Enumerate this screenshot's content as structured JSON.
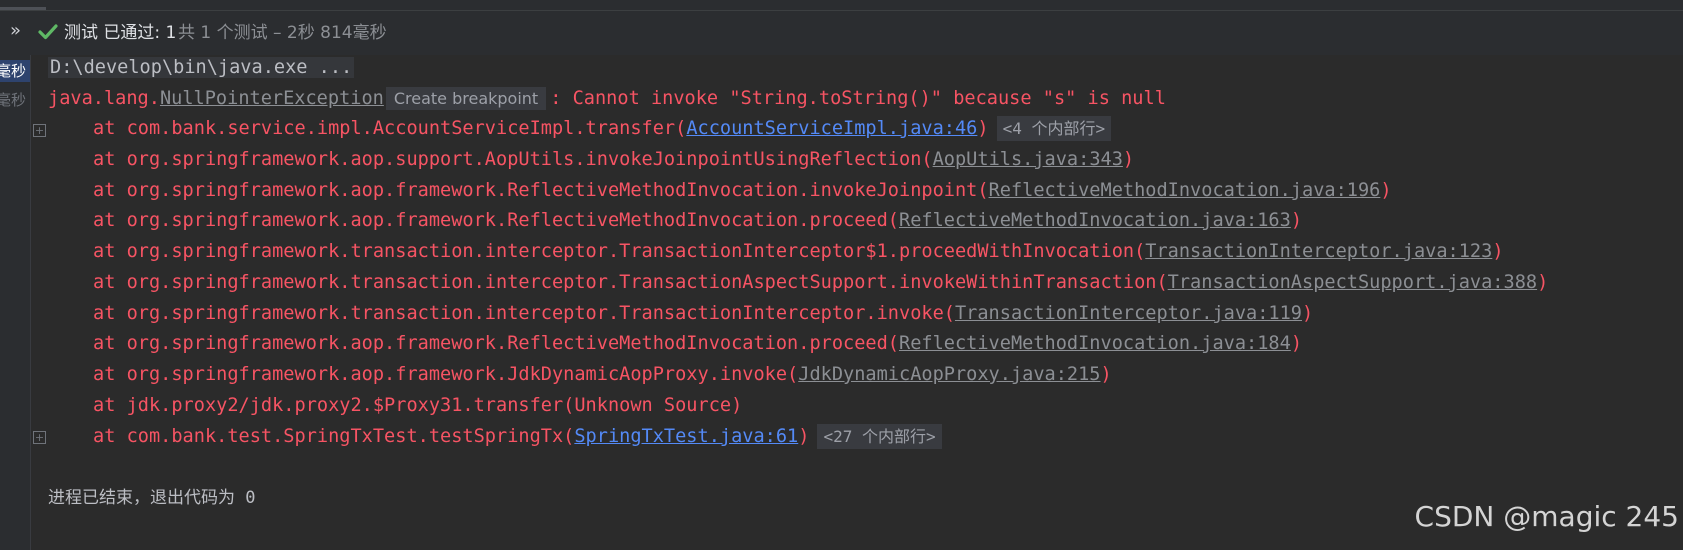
{
  "header": {
    "expand_glyph": "»",
    "status_icon": "check-icon",
    "status_title": "测试 已通过: 1",
    "status_summary": "共 1 个测试 – 2秒 814毫秒"
  },
  "test_tree": {
    "items": [
      {
        "time": "毫秒"
      },
      {
        "time": "毫秒"
      }
    ]
  },
  "console": {
    "command_line": "D:\\develop\\bin\\java.exe ...",
    "exception": {
      "prefix": "java.lang.",
      "class_name": "NullPointerException",
      "breakpoint_hint": "Create breakpoint",
      "message": ": Cannot invoke \"String.toString()\" because \"s\" is null"
    },
    "frames": [
      {
        "method": "at com.bank.service.impl.AccountServiceImpl.transfer(",
        "location": "AccountServiceImpl.java:46",
        "close": ")",
        "folded": "<4 个内部行>"
      },
      {
        "method": "at org.springframework.aop.support.AopUtils.invokeJoinpointUsingReflection(",
        "location": "AopUtils.java:343",
        "close": ")"
      },
      {
        "method": "at org.springframework.aop.framework.ReflectiveMethodInvocation.invokeJoinpoint(",
        "location": "ReflectiveMethodInvocation.java:196",
        "close": ")"
      },
      {
        "method": "at org.springframework.aop.framework.ReflectiveMethodInvocation.proceed(",
        "location": "ReflectiveMethodInvocation.java:163",
        "close": ")"
      },
      {
        "method": "at org.springframework.transaction.interceptor.TransactionInterceptor$1.proceedWithInvocation(",
        "location": "TransactionInterceptor.java:123",
        "close": ")"
      },
      {
        "method": "at org.springframework.transaction.interceptor.TransactionAspectSupport.invokeWithinTransaction(",
        "location": "TransactionAspectSupport.java:388",
        "close": ")"
      },
      {
        "method": "at org.springframework.transaction.interceptor.TransactionInterceptor.invoke(",
        "location": "TransactionInterceptor.java:119",
        "close": ")"
      },
      {
        "method": "at org.springframework.aop.framework.ReflectiveMethodInvocation.proceed(",
        "location": "ReflectiveMethodInvocation.java:184",
        "close": ")"
      },
      {
        "method": "at org.springframework.aop.framework.JdkDynamicAopProxy.invoke(",
        "location": "JdkDynamicAopProxy.java:215",
        "close": ")"
      },
      {
        "text": "at jdk.proxy2/jdk.proxy2.$Proxy31.transfer(Unknown Source)"
      },
      {
        "method": "at com.bank.test.SpringTxTest.testSpringTx(",
        "location": "SpringTxTest.java:61",
        "close": ")",
        "folded": "<27 个内部行>"
      }
    ],
    "fold_glyph": "+",
    "exit_message": "进程已结束，退出代码为 0"
  },
  "watermark": "CSDN @magic 245",
  "colors": {
    "error": "#f75464",
    "source_link": "#548af7",
    "library_link": "#8c8f94",
    "passed": "#5fb865"
  }
}
